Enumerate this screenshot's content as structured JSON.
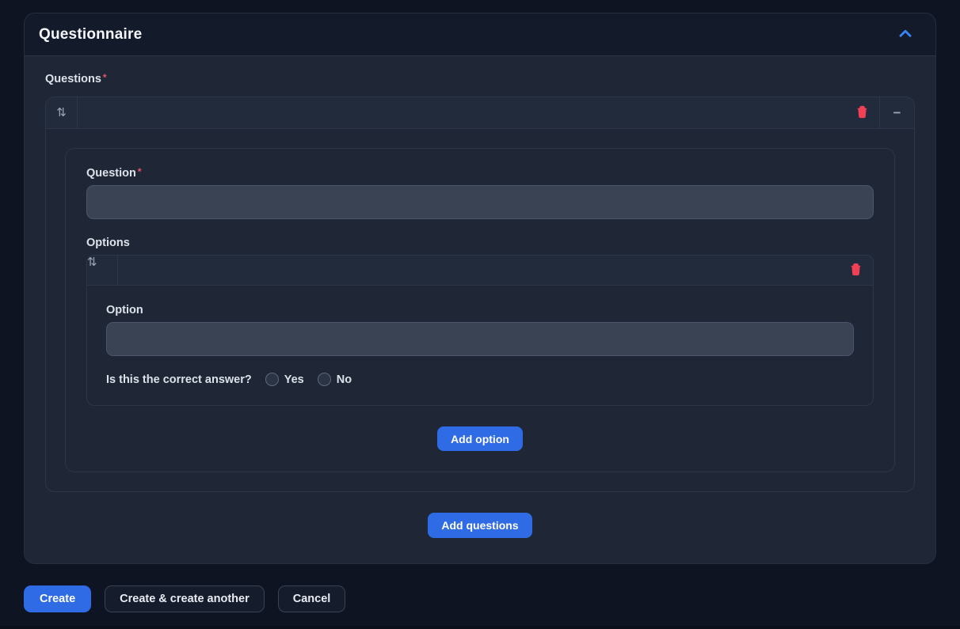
{
  "colors": {
    "primary_blue": "#2e6be5",
    "danger_red": "#ef4056",
    "chevron_blue": "#3b82f6"
  },
  "section": {
    "title": "Questionnaire"
  },
  "questions": {
    "label": "Questions",
    "required": "*",
    "add_button": "Add questions",
    "item": {
      "icons": {
        "sort": "⇅",
        "collapse": "−"
      },
      "question": {
        "label": "Question",
        "required": "*",
        "value": "",
        "placeholder": ""
      },
      "options": {
        "label": "Options",
        "add_button": "Add option",
        "item": {
          "icons": {
            "sort": "⇅"
          },
          "option": {
            "label": "Option",
            "value": "",
            "placeholder": ""
          },
          "correct": {
            "label": "Is this the correct answer?",
            "choices": [
              {
                "label": "Yes"
              },
              {
                "label": "No"
              }
            ]
          }
        }
      }
    }
  },
  "footer": {
    "create": "Create",
    "create_another": "Create & create another",
    "cancel": "Cancel"
  }
}
